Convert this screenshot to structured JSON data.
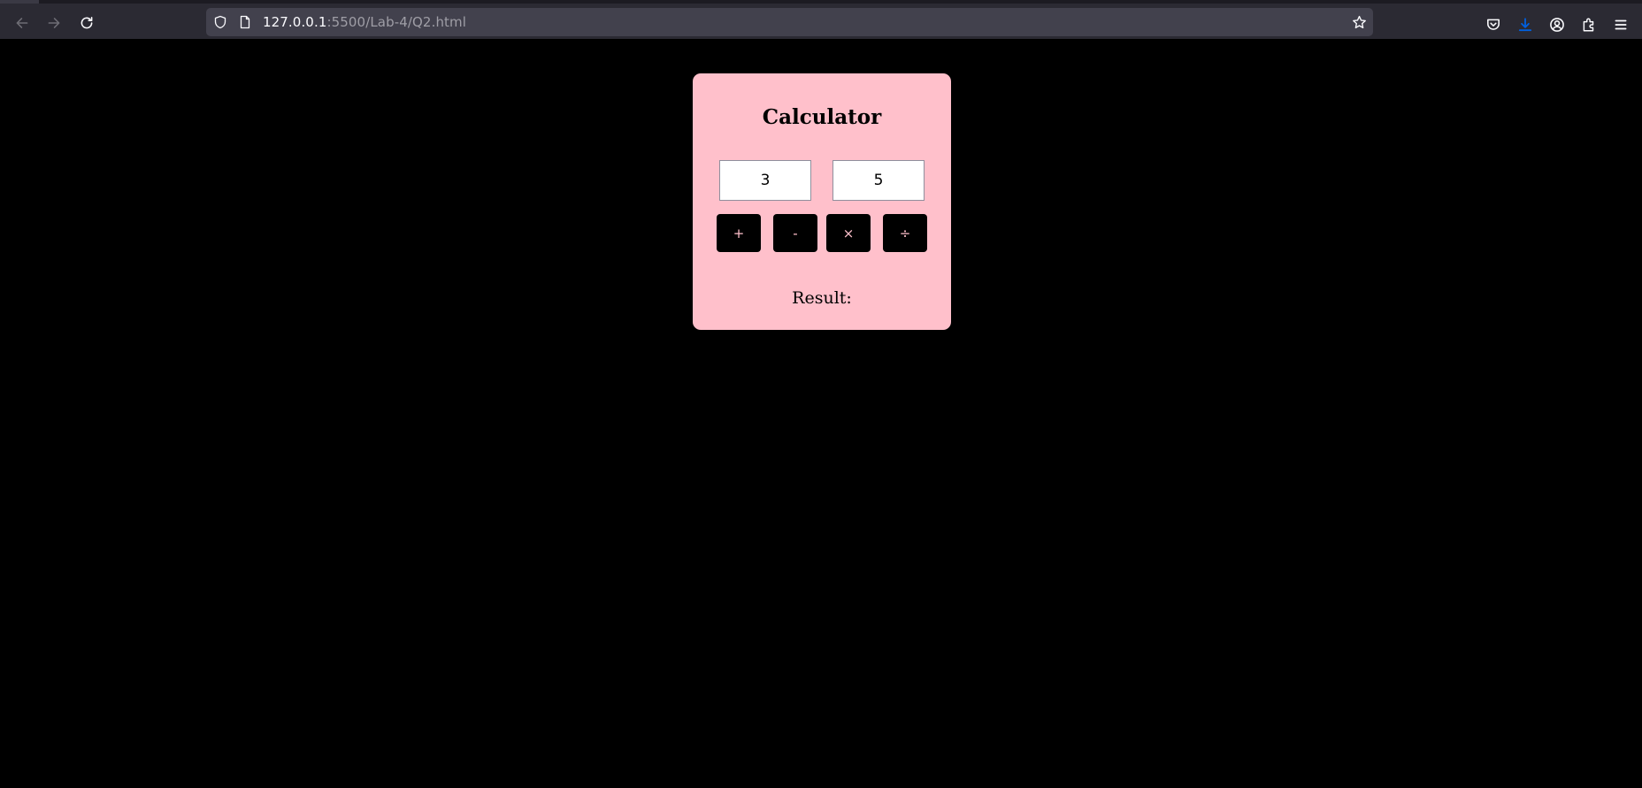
{
  "browser": {
    "url_host": "127.0.0.1",
    "url_rest": ":5500/Lab-4/Q2.html",
    "icons": {
      "back": "arrow-left-icon",
      "forward": "arrow-right-icon",
      "reload": "reload-icon",
      "shield": "shield-icon",
      "page": "page-icon",
      "bookmark": "star-icon",
      "pocket": "pocket-icon",
      "downloads": "download-icon",
      "account": "account-icon",
      "extensions": "puzzle-icon",
      "menu": "hamburger-menu-icon"
    },
    "colors": {
      "toolbar": "#2b2a33",
      "urlbar": "#42414d",
      "download_accent": "#0060df"
    }
  },
  "page": {
    "background": "#000000",
    "calculator": {
      "title": "Calculator",
      "input_a": "3",
      "input_b": "5",
      "operators": {
        "add": "+",
        "subtract": "-",
        "multiply": "×",
        "divide": "÷"
      },
      "result_label": "Result:",
      "card_color": "#ffc0cb"
    }
  }
}
